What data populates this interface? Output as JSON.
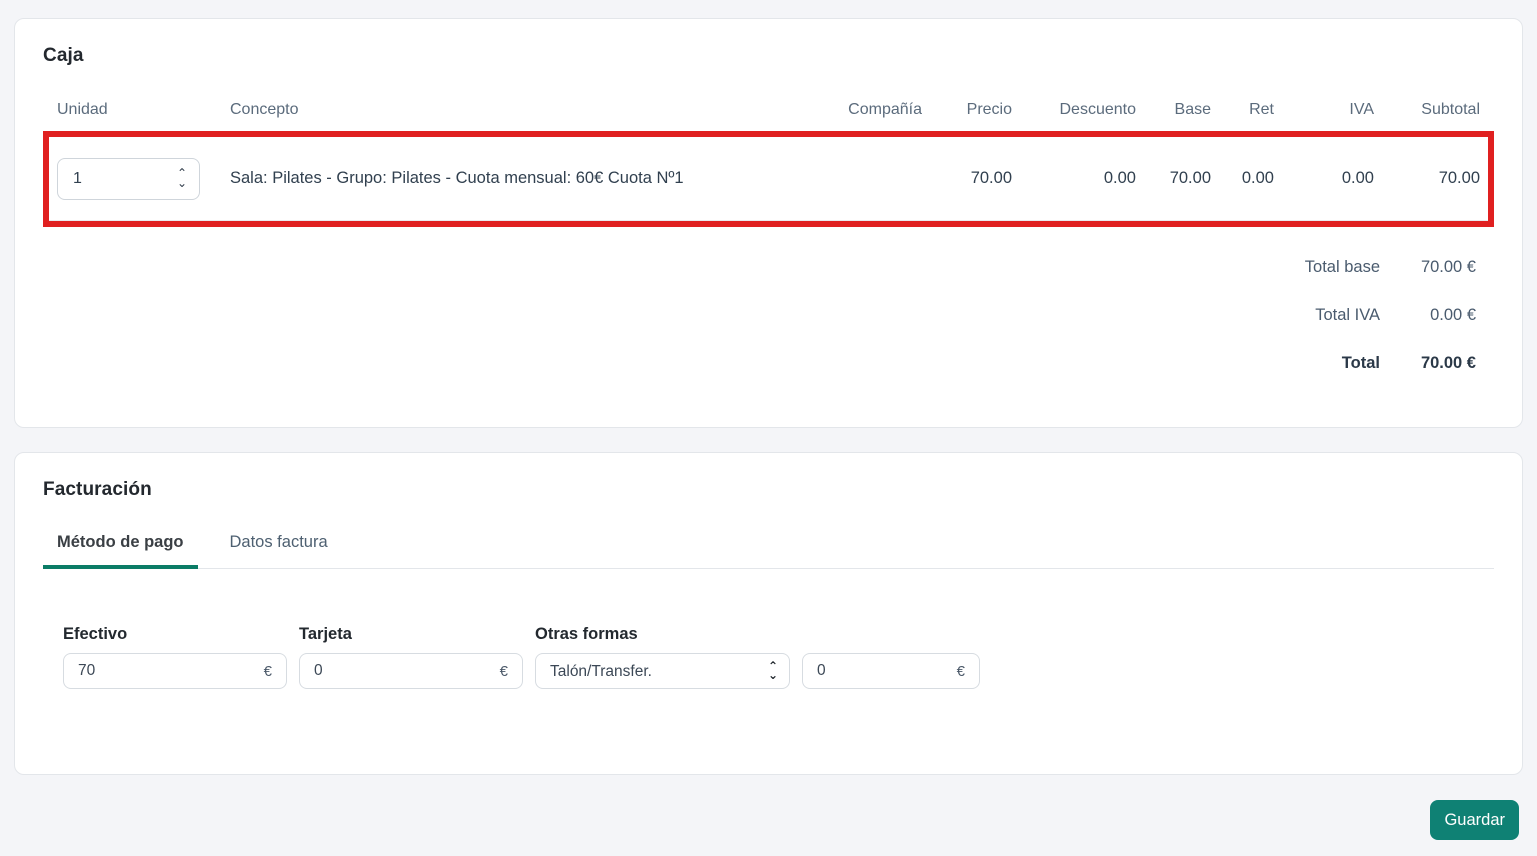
{
  "caja": {
    "title": "Caja",
    "columns": [
      "Unidad",
      "Concepto",
      "Compañía",
      "Precio",
      "Descuento",
      "Base",
      "Ret",
      "IVA",
      "Subtotal"
    ],
    "row": {
      "unidad": "1",
      "concepto": "Sala: Pilates - Grupo: Pilates - Cuota mensual: 60€ Cuota Nº1",
      "compania": "",
      "precio": "70.00",
      "descuento": "0.00",
      "base": "70.00",
      "ret": "0.00",
      "iva": "0.00",
      "subtotal": "70.00"
    },
    "totals": [
      {
        "label": "Total base",
        "value": "70.00 €"
      },
      {
        "label": "Total IVA",
        "value": "0.00 €"
      },
      {
        "label": "Total",
        "value": "70.00 €"
      }
    ]
  },
  "facturacion": {
    "title": "Facturación",
    "tabs": [
      {
        "label": "Método de pago"
      },
      {
        "label": "Datos factura"
      }
    ],
    "fields": {
      "efectivo": {
        "label": "Efectivo",
        "value": "70",
        "suffix": "€"
      },
      "tarjeta": {
        "label": "Tarjeta",
        "value": "0",
        "suffix": "€"
      },
      "otras_formas": {
        "label": "Otras formas",
        "selected": "Talón/Transfer.",
        "amount": "0",
        "suffix": "€"
      }
    }
  },
  "actions": {
    "save_label": "Guardar"
  },
  "colors": {
    "accent_teal": "#0b7c66",
    "button_teal": "#0f8174",
    "highlight_red": "#e02020"
  }
}
